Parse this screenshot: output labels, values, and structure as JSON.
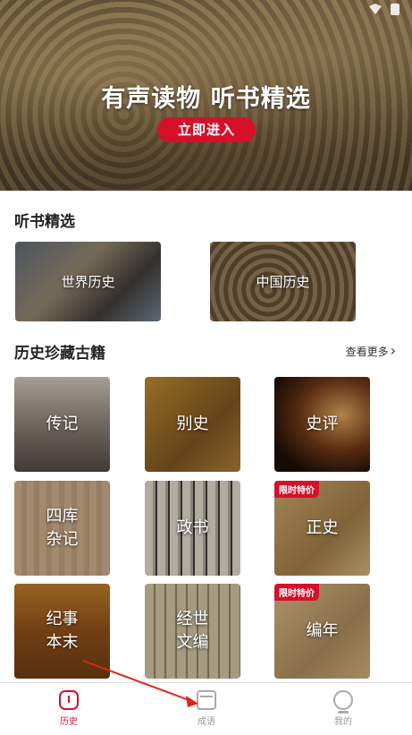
{
  "banner": {
    "title": "有声读物  听书精选",
    "button_label": "立即进入"
  },
  "listen_section": {
    "title": "听书精选",
    "cards": [
      {
        "label": "世界历史"
      },
      {
        "label": "中国历史"
      }
    ]
  },
  "books_section": {
    "title": "历史珍藏古籍",
    "more_label": "查看更多",
    "badge_label": "限时特价",
    "cards": [
      {
        "label": "传记"
      },
      {
        "label": "别史"
      },
      {
        "label": "史评"
      },
      {
        "label": "四库\n杂记"
      },
      {
        "label": "政书"
      },
      {
        "label": "正史"
      },
      {
        "label": "纪事\n本末"
      },
      {
        "label": "经世\n文编"
      },
      {
        "label": "编年"
      }
    ]
  },
  "tabbar": {
    "tabs": [
      {
        "label": "历史",
        "icon": "history-icon"
      },
      {
        "label": "成语",
        "icon": "book-icon"
      },
      {
        "label": "我的",
        "icon": "profile-icon"
      }
    ],
    "active_color": "#d7102a"
  }
}
